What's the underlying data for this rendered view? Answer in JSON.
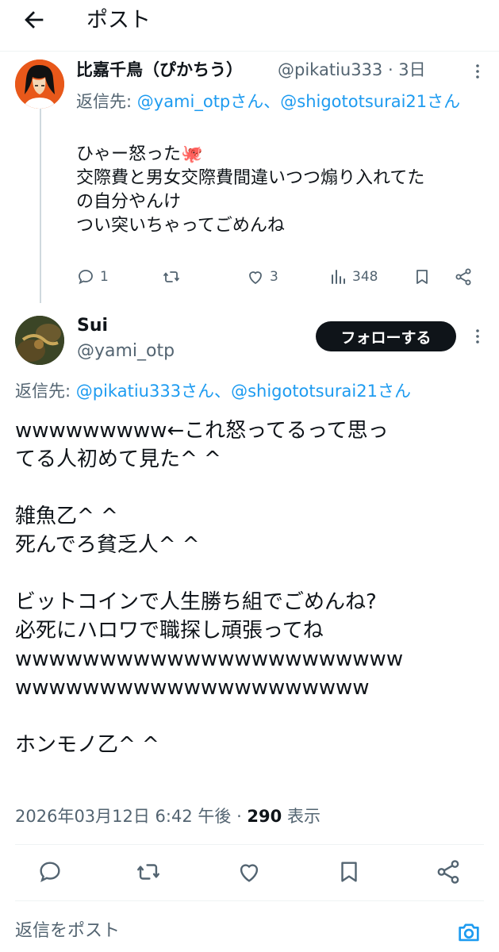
{
  "header": {
    "title": "ポスト"
  },
  "reply_tweet": {
    "name": "比嘉千鳥（ぴかちう）",
    "handle": "@pikatiu333 · 3日",
    "reply_prefix": "返信先: ",
    "reply_mention1": "@yami_otpさん、",
    "reply_mention2": "@shigototsurai21さん",
    "body_lines": [
      "ひゃー怒った🐙",
      "交際費と男女交際費間違いつつ煽り入れてた",
      "の自分やんけ",
      "つい突いちゃってごめんね"
    ],
    "reply_count": "1",
    "like_count": "3",
    "view_count": "348"
  },
  "main_tweet": {
    "name": "Sui",
    "handle": "@yami_otp",
    "follow_label": "フォローする",
    "reply_prefix": "返信先: ",
    "reply_mention1": "@pikatiu333さん、",
    "reply_mention2": "@shigototsurai21さん",
    "body_lines": [
      "wwwwwwwww←これ怒ってるって思っ",
      "てる人初めて見た^ ^",
      "",
      "雑魚乙^ ^",
      "死んでろ貧乏人^ ^",
      "",
      "ビットコインで人生勝ち組でごめんね?",
      "必死にハロワで職探し頑張ってね",
      "wwwwwwwwwwwwwwwwwwwwwww",
      "wwwwwwwwwwwwwwwwwwwww",
      "",
      "ホンモノ乙^ ^"
    ],
    "timestamp": "2026年03月12日 6:42 午後 · ",
    "views_count": "290",
    "views_label": " 表示"
  },
  "reply_bar": {
    "placeholder": "返信をポスト"
  },
  "colors": {
    "accent": "#1d9bf0",
    "text": "#0f1419",
    "secondary": "#536471"
  }
}
